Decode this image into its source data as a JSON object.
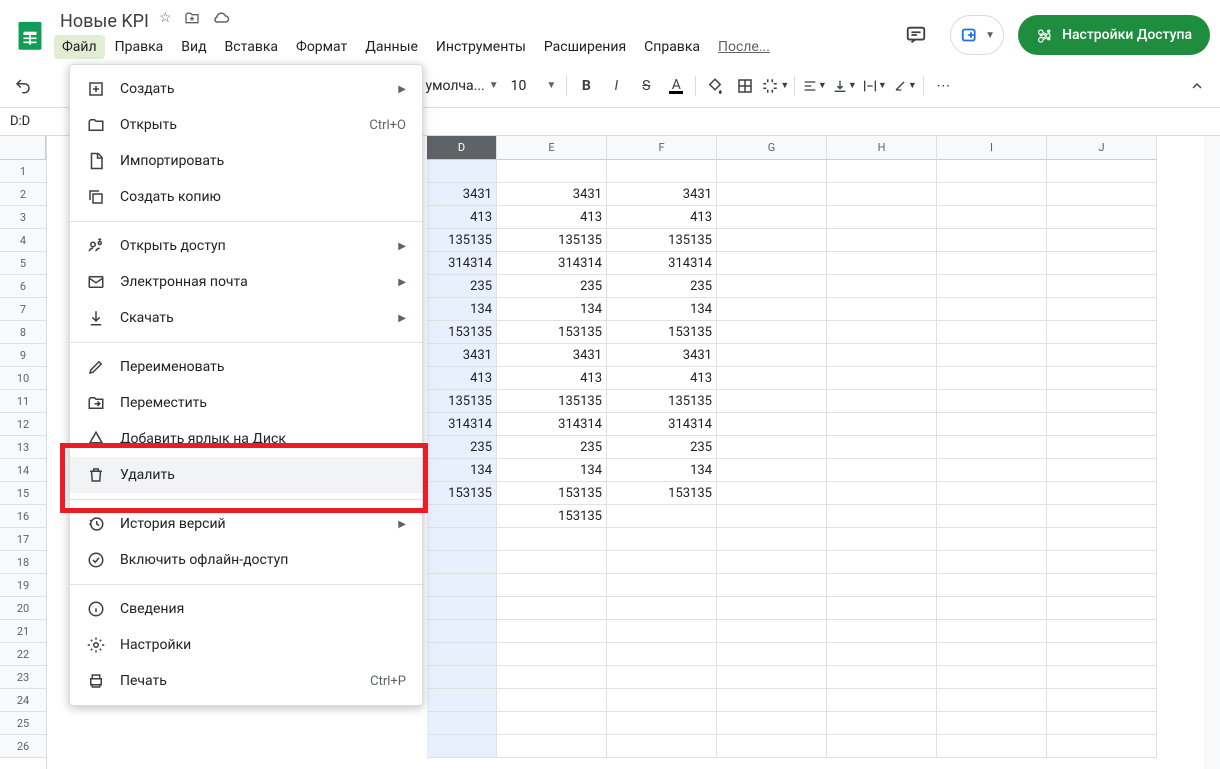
{
  "doc_title": "Новые KPI",
  "menus": [
    "Файл",
    "Правка",
    "Вид",
    "Вставка",
    "Формат",
    "Данные",
    "Инструменты",
    "Расширения",
    "Справка",
    "После..."
  ],
  "share_button": "Настройки Доступа",
  "toolbar": {
    "font": "По умолча...",
    "size": "10"
  },
  "namebox": "D:D",
  "col_widths": {
    "D": 70,
    "E": 110,
    "F": 110,
    "G": 110,
    "H": 110,
    "I": 110,
    "J": 110
  },
  "columns": [
    "D",
    "E",
    "F",
    "G",
    "H",
    "I",
    "J"
  ],
  "row_count": 26,
  "data": {
    "2": {
      "D": "3431",
      "E": "3431",
      "F": "3431"
    },
    "3": {
      "D": "413",
      "E": "413",
      "F": "413"
    },
    "4": {
      "D": "135135",
      "E": "135135",
      "F": "135135"
    },
    "5": {
      "D": "314314",
      "E": "314314",
      "F": "314314"
    },
    "6": {
      "D": "235",
      "E": "235",
      "F": "235"
    },
    "7": {
      "D": "134",
      "E": "134",
      "F": "134"
    },
    "8": {
      "D": "153135",
      "E": "153135",
      "F": "153135"
    },
    "9": {
      "D": "3431",
      "E": "3431",
      "F": "3431"
    },
    "10": {
      "D": "413",
      "E": "413",
      "F": "413"
    },
    "11": {
      "D": "135135",
      "E": "135135",
      "F": "135135"
    },
    "12": {
      "D": "314314",
      "E": "314314",
      "F": "314314"
    },
    "13": {
      "D": "235",
      "E": "235",
      "F": "235"
    },
    "14": {
      "D": "134",
      "E": "134",
      "F": "134"
    },
    "15": {
      "D": "153135",
      "E": "153135",
      "F": "153135"
    },
    "16": {
      "E": "153135"
    }
  },
  "dropdown": [
    {
      "type": "item",
      "icon": "new",
      "label": "Создать",
      "sub": true
    },
    {
      "type": "item",
      "icon": "open",
      "label": "Открыть",
      "shortcut": "Ctrl+O"
    },
    {
      "type": "item",
      "icon": "import",
      "label": "Импортировать"
    },
    {
      "type": "item",
      "icon": "copy",
      "label": "Создать копию"
    },
    {
      "type": "sep"
    },
    {
      "type": "item",
      "icon": "share",
      "label": "Открыть доступ",
      "sub": true
    },
    {
      "type": "item",
      "icon": "email",
      "label": "Электронная почта",
      "sub": true
    },
    {
      "type": "item",
      "icon": "download",
      "label": "Скачать",
      "sub": true
    },
    {
      "type": "sep"
    },
    {
      "type": "item",
      "icon": "rename",
      "label": "Переименовать"
    },
    {
      "type": "item",
      "icon": "move",
      "label": "Переместить"
    },
    {
      "type": "item",
      "icon": "drive",
      "label": "Добавить ярлык на Диск"
    },
    {
      "type": "item",
      "icon": "trash",
      "label": "Удалить",
      "hl": true
    },
    {
      "type": "sep"
    },
    {
      "type": "item",
      "icon": "history",
      "label": "История версий",
      "sub": true
    },
    {
      "type": "item",
      "icon": "offline",
      "label": "Включить офлайн-доступ"
    },
    {
      "type": "sep"
    },
    {
      "type": "item",
      "icon": "info",
      "label": "Сведения"
    },
    {
      "type": "item",
      "icon": "settings",
      "label": "Настройки"
    },
    {
      "type": "item",
      "icon": "print",
      "label": "Печать",
      "shortcut": "Ctrl+P"
    }
  ]
}
